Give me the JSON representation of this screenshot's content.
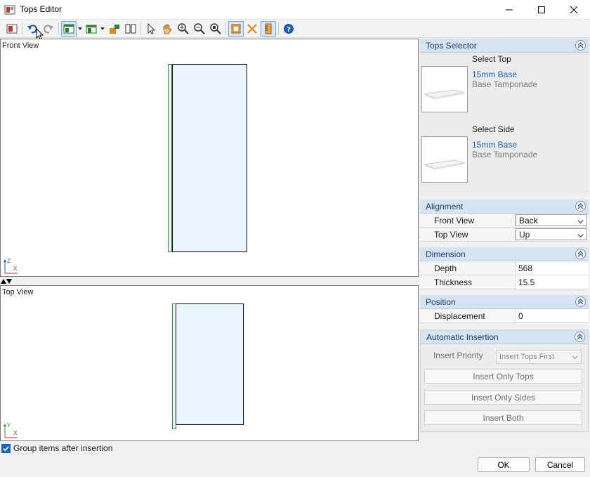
{
  "window": {
    "title": "Tops Editor",
    "minimize_icon": "minimize-icon",
    "maximize_icon": "maximize-icon",
    "close_icon": "close-icon"
  },
  "toolbar": {
    "icons": [
      "tops-editor-icon",
      "undo-icon",
      "redo-icon",
      "layout-icon",
      "layout-2-icon",
      "insert-icon",
      "split-icon",
      "select-arrow-icon",
      "pan-hand-icon",
      "zoom-region-icon",
      "zoom-out-icon",
      "zoom-fit-icon",
      "snap-icon",
      "delete-icon",
      "measure-icon",
      "help-icon"
    ]
  },
  "front_view": {
    "label": "Front View",
    "axis_v": "Z",
    "axis_h": "X"
  },
  "top_view": {
    "label": "Top View",
    "axis_v": "Y",
    "axis_h": "X"
  },
  "group_checkbox": {
    "label": "Group items after insertion",
    "checked": true
  },
  "tops_selector": {
    "header": "Tops Selector",
    "top": {
      "caption": "Select Top",
      "name": "15mm Base",
      "sub": "Base Tamponade"
    },
    "side": {
      "caption": "Select Side",
      "name": "15mm Base",
      "sub": "Base Tamponade"
    }
  },
  "alignment": {
    "header": "Alignment",
    "rows": [
      {
        "key": "Front View",
        "value": "Back"
      },
      {
        "key": "Top View",
        "value": "Up"
      }
    ]
  },
  "dimension": {
    "header": "Dimension",
    "rows": [
      {
        "key": "Depth",
        "value": "568"
      },
      {
        "key": "Thickness",
        "value": "15.5"
      }
    ]
  },
  "position": {
    "header": "Position",
    "rows": [
      {
        "key": "Displacement",
        "value": "0"
      }
    ]
  },
  "automatic_insertion": {
    "header": "Automatic Insertion",
    "priority_label": "Insert Priority",
    "priority_value": "Insert Tops First",
    "buttons": [
      "Insert Only Tops",
      "Insert Only Sides",
      "Insert Both"
    ]
  },
  "dialog": {
    "ok": "OK",
    "cancel": "Cancel"
  },
  "colors": {
    "accent": "#1a63c4",
    "panel_header": "#d6e3f1",
    "shape_fill": "#eaf4fe",
    "edge_green": "#2e8b2e"
  }
}
